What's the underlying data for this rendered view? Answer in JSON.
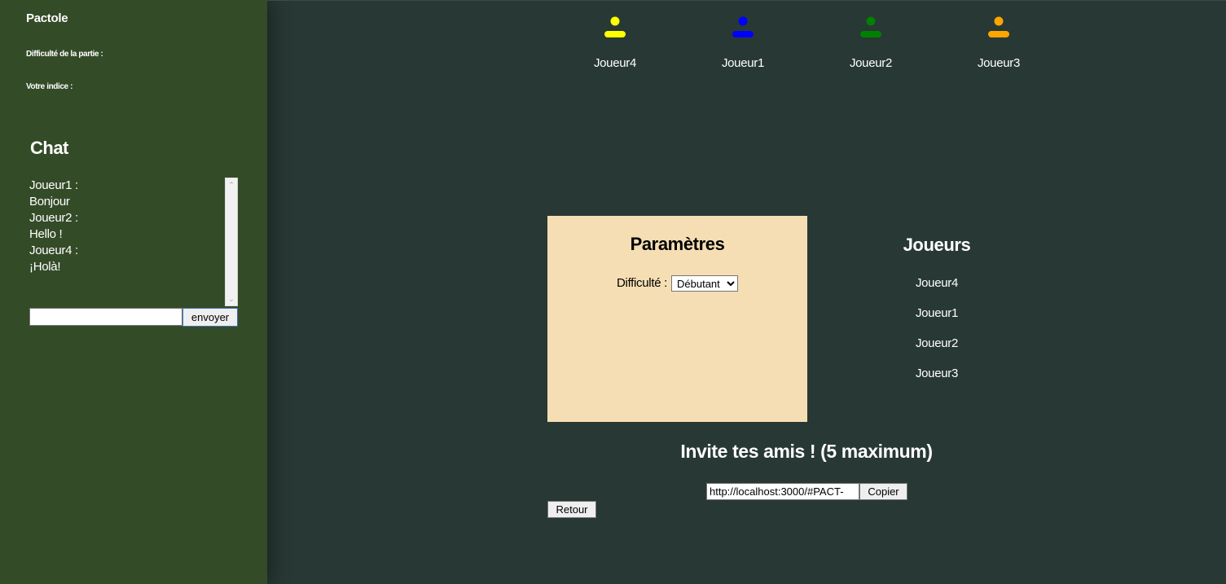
{
  "sidebar": {
    "app_title": "Pactole",
    "difficulty_label": "Difficulté de la partie :",
    "hint_label": "Votre indice :",
    "background": "#344b28"
  },
  "chat": {
    "title": "Chat",
    "messages": [
      {
        "author": "Joueur1 :",
        "text": "Bonjour"
      },
      {
        "author": "Joueur2 :",
        "text": "Hello !"
      },
      {
        "author": "Joueur4 :",
        "text": "¡Holà!"
      }
    ],
    "input_value": "",
    "send_label": "envoyer"
  },
  "top_players": [
    {
      "name": "Joueur4",
      "color": "#ffff00",
      "icon": "user-icon"
    },
    {
      "name": "Joueur1",
      "color": "#0000ff",
      "icon": "user-icon"
    },
    {
      "name": "Joueur2",
      "color": "#008000",
      "icon": "user-icon"
    },
    {
      "name": "Joueur3",
      "color": "#ffa500",
      "icon": "user-icon"
    }
  ],
  "settings": {
    "title": "Paramètres",
    "difficulty_label": "Difficulté :",
    "difficulty_value": "Débutant",
    "background": "#f5deb3"
  },
  "players_panel": {
    "title": "Joueurs",
    "players": [
      "Joueur4",
      "Joueur1",
      "Joueur2",
      "Joueur3"
    ]
  },
  "invite": {
    "title": "Invite tes amis ! (5 maximum)",
    "link_value": "http://localhost:3000/#PACT-",
    "copy_label": "Copier"
  },
  "back_label": "Retour",
  "colors": {
    "main_background": "#283834",
    "text": "#ffffff"
  }
}
